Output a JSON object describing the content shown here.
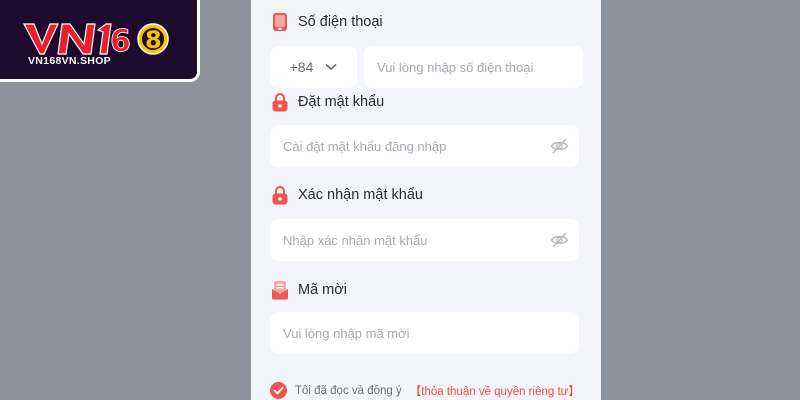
{
  "brand": {
    "logo_text": "VN168",
    "url": "VN168VN.SHOP",
    "colors": {
      "banner": "#1d0a2c",
      "logo_red": "#e8202a",
      "logo_gold": "#f5c400"
    }
  },
  "form": {
    "phone": {
      "label": "Số điện thoại",
      "icon": "phone-icon",
      "country_code": "+84",
      "placeholder": "Vui lòng nhập số điện thoại"
    },
    "password": {
      "label": "Đặt mật khẩu",
      "icon": "lock-icon",
      "placeholder": "Cài đặt mật khẩu đăng nhập"
    },
    "confirm_password": {
      "label": "Xác nhận mật khẩu",
      "icon": "lock-icon",
      "placeholder": "Nhập xác nhận mật khẩu"
    },
    "invite_code": {
      "label": "Mã mời",
      "icon": "invite-icon",
      "placeholder": "Vui lòng nhập mã mời"
    },
    "consent": {
      "text": "Tôi đã đọc và đồng ý",
      "link": "【thỏa thuận về quyền riêng tư】",
      "checked": true
    },
    "accent_color": "#f0554f"
  }
}
